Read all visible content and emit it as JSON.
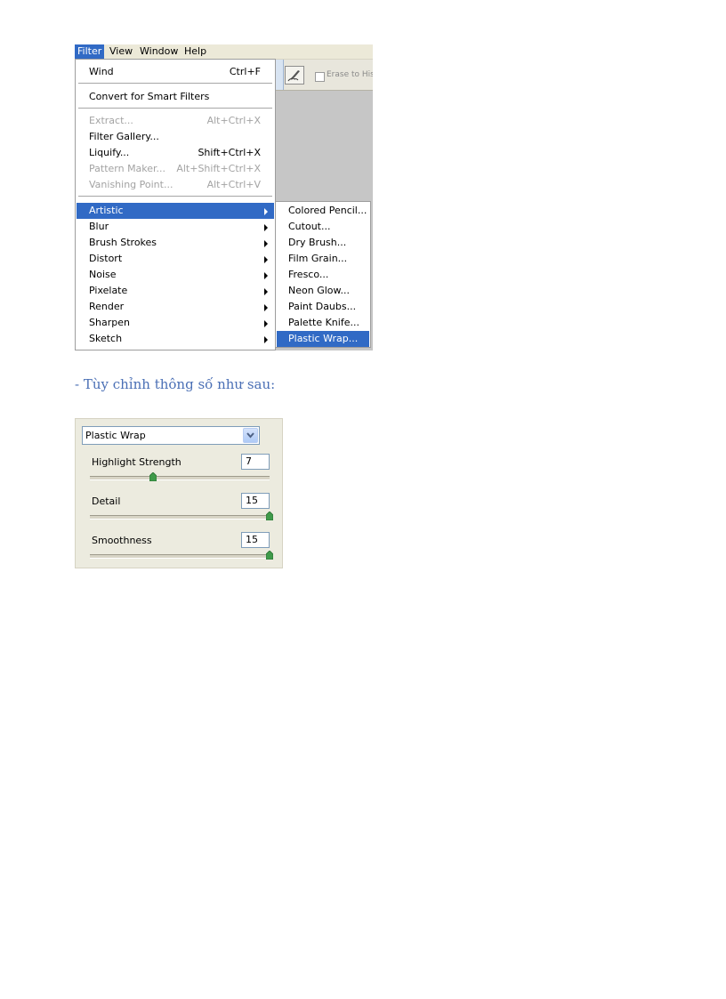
{
  "menubar": {
    "items": [
      "Filter",
      "View",
      "Window",
      "Help"
    ],
    "active_index": 0
  },
  "toolbar": {
    "erase_label": "Erase to His"
  },
  "filter_menu": {
    "top_items": [
      {
        "label": "Wind",
        "shortcut": "Ctrl+F",
        "enabled": true
      },
      {
        "label": "Convert for Smart Filters",
        "shortcut": "",
        "enabled": true
      }
    ],
    "middle_items": [
      {
        "label": "Extract...",
        "shortcut": "Alt+Ctrl+X",
        "enabled": false
      },
      {
        "label": "Filter Gallery...",
        "shortcut": "",
        "enabled": true
      },
      {
        "label": "Liquify...",
        "shortcut": "Shift+Ctrl+X",
        "enabled": true
      },
      {
        "label": "Pattern Maker...",
        "shortcut": "Alt+Shift+Ctrl+X",
        "enabled": false
      },
      {
        "label": "Vanishing Point...",
        "shortcut": "Alt+Ctrl+V",
        "enabled": false
      }
    ],
    "submenu_items": [
      "Artistic",
      "Blur",
      "Brush Strokes",
      "Distort",
      "Noise",
      "Pixelate",
      "Render",
      "Sharpen",
      "Sketch"
    ],
    "highlighted_submenu": "Artistic"
  },
  "artistic_submenu": {
    "items": [
      "Colored Pencil...",
      "Cutout...",
      "Dry Brush...",
      "Film Grain...",
      "Fresco...",
      "Neon Glow...",
      "Paint Daubs...",
      "Palette Knife...",
      "Plastic Wrap..."
    ],
    "highlighted": "Plastic Wrap..."
  },
  "caption": "- Tùy chỉnh thông số như sau:",
  "plastic_wrap_panel": {
    "selected_filter": "Plastic Wrap",
    "params": [
      {
        "label": "Highlight Strength",
        "value": "7",
        "fraction": 0.35
      },
      {
        "label": "Detail",
        "value": "15",
        "fraction": 1.0
      },
      {
        "label": "Smoothness",
        "value": "15",
        "fraction": 1.0
      }
    ]
  },
  "colors": {
    "highlight": "#316ac5",
    "caption": "#4a6fb5",
    "panel_bg": "#ecebdf"
  }
}
